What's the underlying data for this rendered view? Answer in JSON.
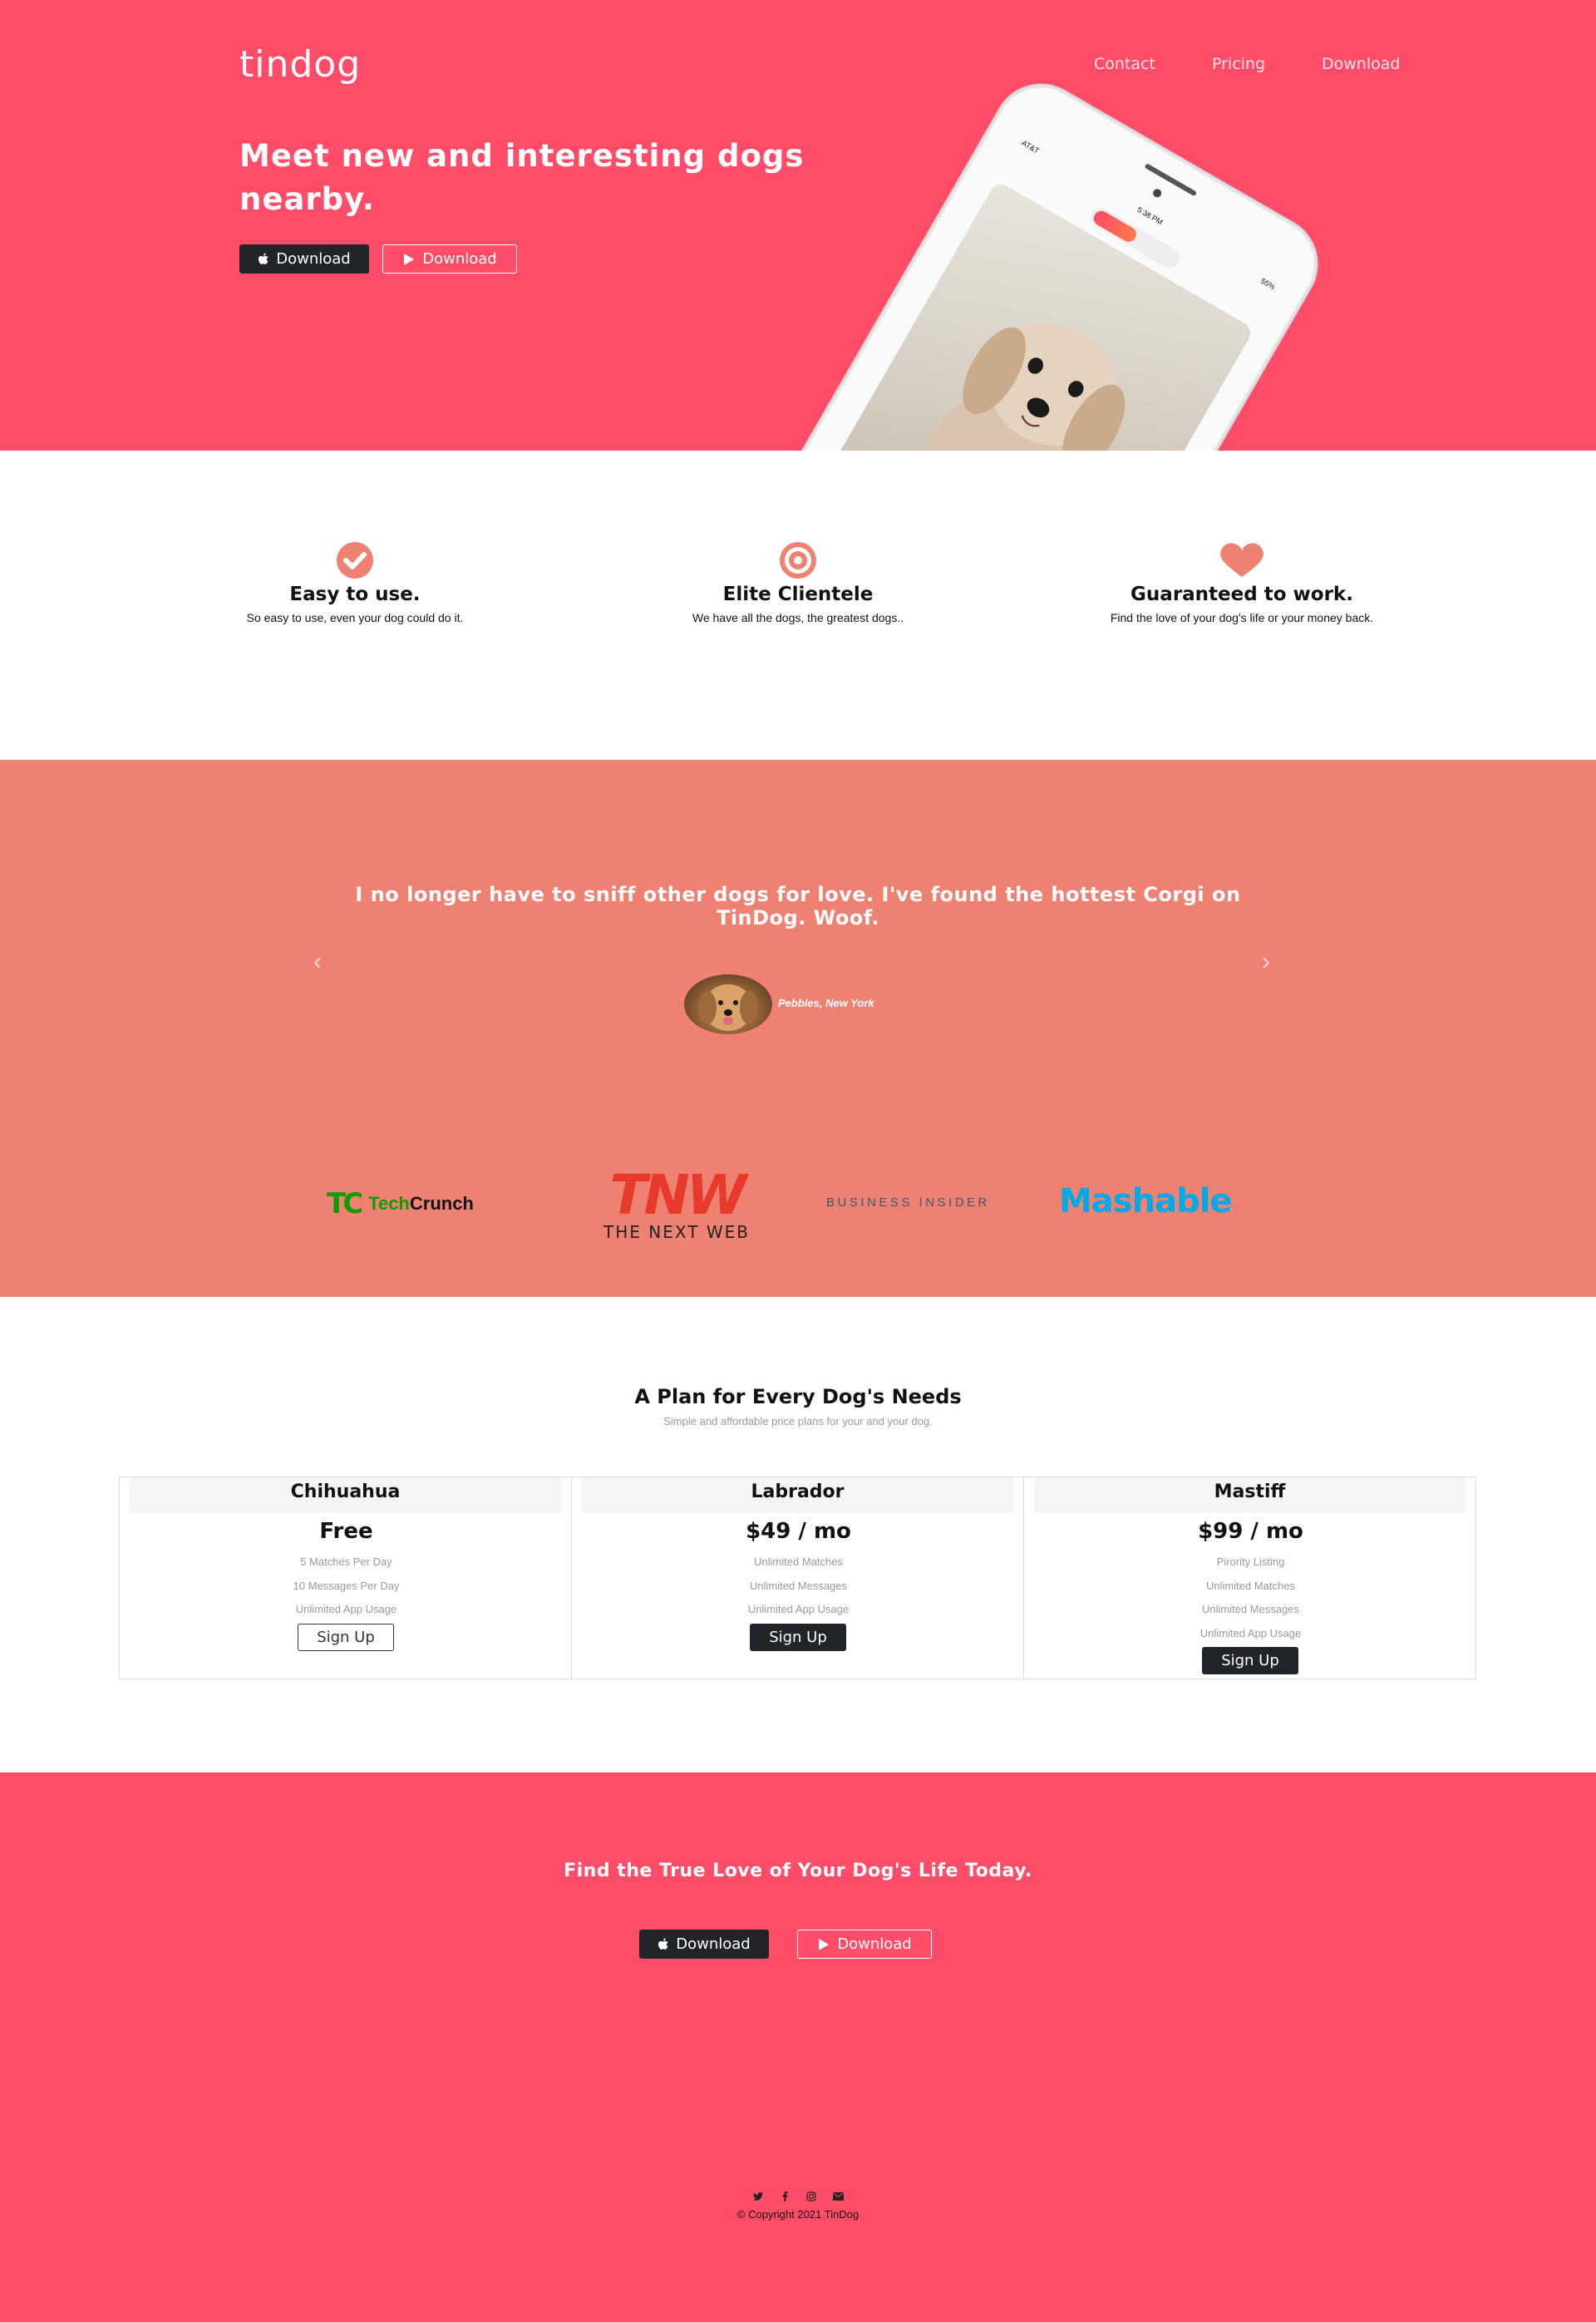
{
  "header": {
    "brand": "tindog",
    "nav": [
      "Contact",
      "Pricing",
      "Download"
    ],
    "title": "Meet new and interesting dogs nearby.",
    "buttons": [
      {
        "label": "Download",
        "icon": "apple-icon"
      },
      {
        "label": "Download",
        "icon": "play-store-icon"
      }
    ],
    "phone": {
      "carrier": "AT&T",
      "time": "5:38 PM",
      "battery": "55%"
    }
  },
  "features": [
    {
      "icon": "check-circle-icon",
      "title": "Easy to use.",
      "description": "So easy to use, even your dog could do it."
    },
    {
      "icon": "bullseye-icon",
      "title": "Elite Clientele",
      "description": "We have all the dogs, the greatest dogs.."
    },
    {
      "icon": "heart-icon",
      "title": "Guaranteed to work.",
      "description": "Find the love of your dog's life or your money back."
    }
  ],
  "testimonial": {
    "quote": "I no longer have to sniff other dogs for love. I've found the hottest Corgi on TinDog. Woof.",
    "author": "Pebbles, New York",
    "prev": "‹",
    "next": "›"
  },
  "press": {
    "techcrunch": {
      "mark": "TC",
      "word1": "Tech",
      "word2": "Crunch"
    },
    "tnw": {
      "mark": "TNW",
      "sub": "THE NEXT WEB"
    },
    "business_insider": "BUSINESS INSIDER",
    "mashable": "Mashable"
  },
  "pricing": {
    "title": "A Plan for Every Dog's Needs",
    "subtitle": "Simple and affordable price plans for your and your dog.",
    "plans": [
      {
        "name": "Chihuahua",
        "price": "Free",
        "features": [
          "5 Matches Per Day",
          "10 Messages Per Day",
          "Unlimited App Usage"
        ],
        "button": "Sign Up"
      },
      {
        "name": "Labrador",
        "price": "$49 / mo",
        "features": [
          "Unlimited Matches",
          "Unlimited Messages",
          "Unlimited App Usage"
        ],
        "button": "Sign Up"
      },
      {
        "name": "Mastiff",
        "price": "$99 / mo",
        "features": [
          "Pirority Listing",
          "Unlimited Matches",
          "Unlimited Messages",
          "Unlimited App Usage"
        ],
        "button": "Sign Up"
      }
    ]
  },
  "cta": {
    "title": "Find the True Love of Your Dog's Life Today.",
    "buttons": [
      {
        "label": "Download",
        "icon": "apple-icon"
      },
      {
        "label": "Download",
        "icon": "play-store-icon"
      }
    ]
  },
  "footer": {
    "social": [
      "twitter-icon",
      "facebook-icon",
      "instagram-icon",
      "envelope-icon"
    ],
    "copyright": "© Copyright 2021 TinDog"
  },
  "colors": {
    "primary": "#ff4c68",
    "testimonial_bg": "#ef8172",
    "dark": "#212529",
    "accent_icon": "#ef8172"
  }
}
